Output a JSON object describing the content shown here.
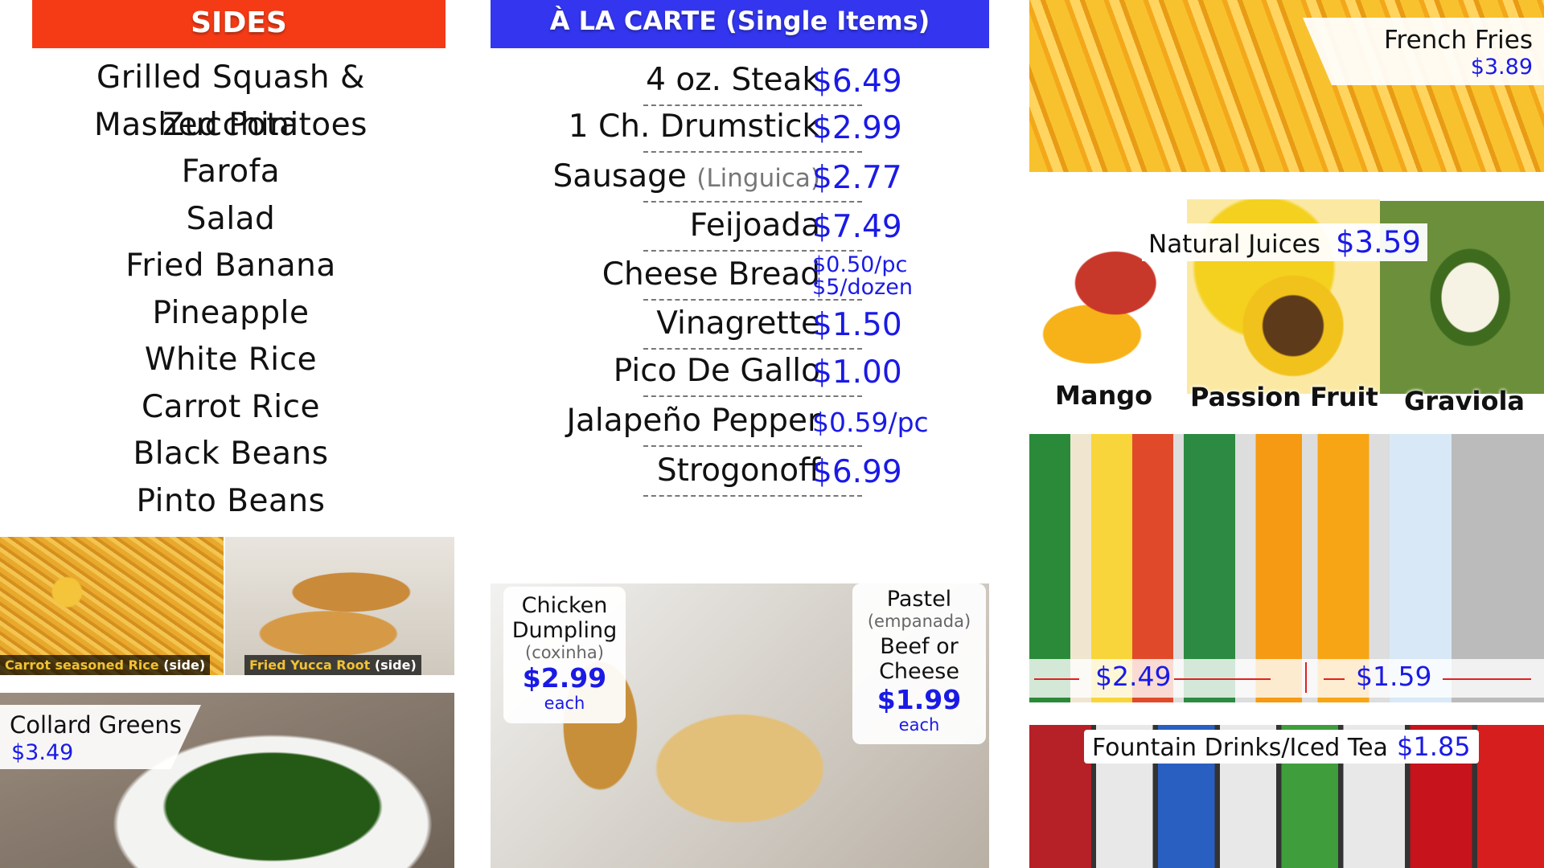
{
  "sides": {
    "header": "SIDES",
    "items": [
      "Grilled Squash & Zucchini",
      "Mashed Potatoes",
      "Farofa",
      "Salad",
      "Fried Banana",
      "Pineapple",
      "White Rice",
      "Carrot Rice",
      "Black Beans",
      "Pinto Beans"
    ],
    "photo1_caption": "Carrot seasoned Rice",
    "photo1_tag": "(side)",
    "photo2_caption": "Fried Yucca Root",
    "photo2_tag": "(side)",
    "collard_name": "Collard Greens",
    "collard_price": "$3.49"
  },
  "alacarte": {
    "header": "À LA CARTE (Single Items)",
    "items": [
      {
        "name": "4 oz. Steak",
        "sub": "",
        "price": "$6.49",
        "price2": ""
      },
      {
        "name": "1 Ch. Drumstick",
        "sub": "",
        "price": "$2.99",
        "price2": ""
      },
      {
        "name": "Sausage",
        "sub": "(Linguica)",
        "price": "$2.77",
        "price2": ""
      },
      {
        "name": "Feijoada",
        "sub": "",
        "price": "$7.49",
        "price2": ""
      },
      {
        "name": "Cheese Bread",
        "sub": "",
        "price": "$0.50/pc",
        "price2": "$5/dozen"
      },
      {
        "name": "Vinagrette",
        "sub": "",
        "price": "$1.50",
        "price2": ""
      },
      {
        "name": "Pico De Gallo",
        "sub": "",
        "price": "$1.00",
        "price2": ""
      },
      {
        "name": "Jalapeño Pepper",
        "sub": "",
        "price": "$0.59/pc",
        "price2": ""
      },
      {
        "name": "Strogonoff",
        "sub": "",
        "price": "$6.99",
        "price2": ""
      }
    ],
    "coxinha": {
      "line1": "Chicken",
      "line2": "Dumpling",
      "sub": "(coxinha)",
      "price": "$2.99",
      "unit": "each"
    },
    "pastel": {
      "line1": "Pastel",
      "sub": "(empanada)",
      "line2": "Beef or",
      "line3": "Cheese",
      "price": "$1.99",
      "unit": "each"
    }
  },
  "right": {
    "fries_name": "French Fries",
    "fries_price": "$3.89",
    "juices_label": "Natural Juices",
    "juices_price": "$3.59",
    "fruits": [
      "Mango",
      "Passion Fruit",
      "Graviola"
    ],
    "bottle_price_left": "$2.49",
    "bottle_price_right": "$1.59",
    "fountain_label": "Fountain Drinks/Iced Tea",
    "fountain_price": "$1.85"
  },
  "colors": {
    "sides_header": "#f53b16",
    "alacarte_header": "#3336ee",
    "price_blue": "#1a1ae6"
  }
}
